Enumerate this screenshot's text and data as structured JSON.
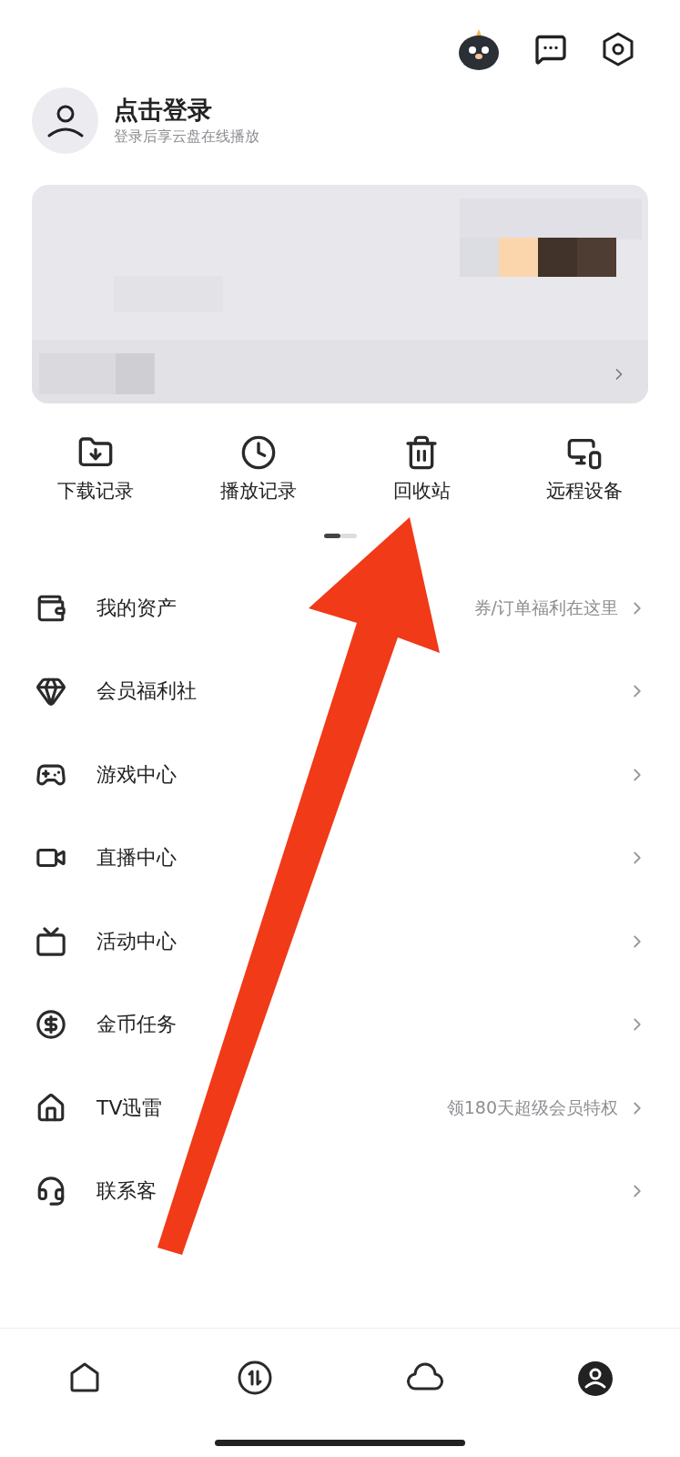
{
  "profile": {
    "title": "点击登录",
    "subtitle": "登录后享云盘在线播放"
  },
  "shortcuts": [
    {
      "label": "下载记录"
    },
    {
      "label": "播放记录"
    },
    {
      "label": "回收站"
    },
    {
      "label": "远程设备"
    }
  ],
  "pager": [
    {
      "selected": true
    },
    {
      "selected": false
    }
  ],
  "menu": [
    {
      "label": "我的资产",
      "hint": "券/订单福利在这里"
    },
    {
      "label": "会员福利社"
    },
    {
      "label": "游戏中心"
    },
    {
      "label": "直播中心"
    },
    {
      "label": "活动中心"
    },
    {
      "label": "金币任务"
    },
    {
      "label": "TV迅雷",
      "hint": "领180天超级会员特权"
    },
    {
      "label": "联系客"
    }
  ],
  "nav": [
    {
      "selected": false
    },
    {
      "selected": false
    },
    {
      "selected": false
    },
    {
      "selected": true
    }
  ]
}
